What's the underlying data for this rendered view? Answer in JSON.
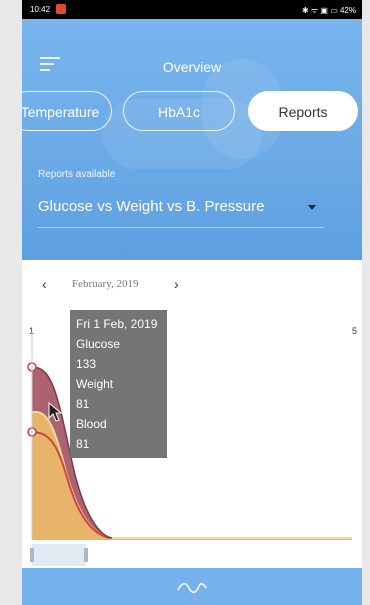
{
  "status_bar": {
    "time": "10:42",
    "right": "✱ ᯤ ▣ ▭ 42%"
  },
  "header": {
    "title": "Overview"
  },
  "tabs": [
    {
      "label": "Temperature",
      "active": false
    },
    {
      "label": "HbA1c",
      "active": false
    },
    {
      "label": "Reports",
      "active": true
    }
  ],
  "reports": {
    "label": "Reports available",
    "selected": "Glucose vs Weight vs B. Pressure"
  },
  "month_nav": {
    "prev_icon": "chevron-left-icon",
    "month": "February, 2019",
    "next_icon": "chevron-right-icon"
  },
  "chart": {
    "tick_left": "1",
    "tick_right": "5"
  },
  "tooltip": {
    "date": "Fri 1 Feb, 2019",
    "glucose_label": "Glucose",
    "glucose_value": "133",
    "weight_label": "Weight",
    "weight_value": "81",
    "blood_label": "Blood",
    "blood_value": "81"
  },
  "chart_data": {
    "type": "area",
    "series": [
      {
        "name": "Glucose",
        "color": "#a85a68"
      },
      {
        "name": "Weight",
        "color": "#e8b46a"
      },
      {
        "name": "Blood",
        "color": "#d2433a"
      }
    ]
  },
  "colors": {
    "header": "#6aa9e6",
    "bottom_bar": "#75b1ec",
    "glucose": "#a85a68",
    "weight": "#e8b46a",
    "blood": "#d2433a"
  }
}
